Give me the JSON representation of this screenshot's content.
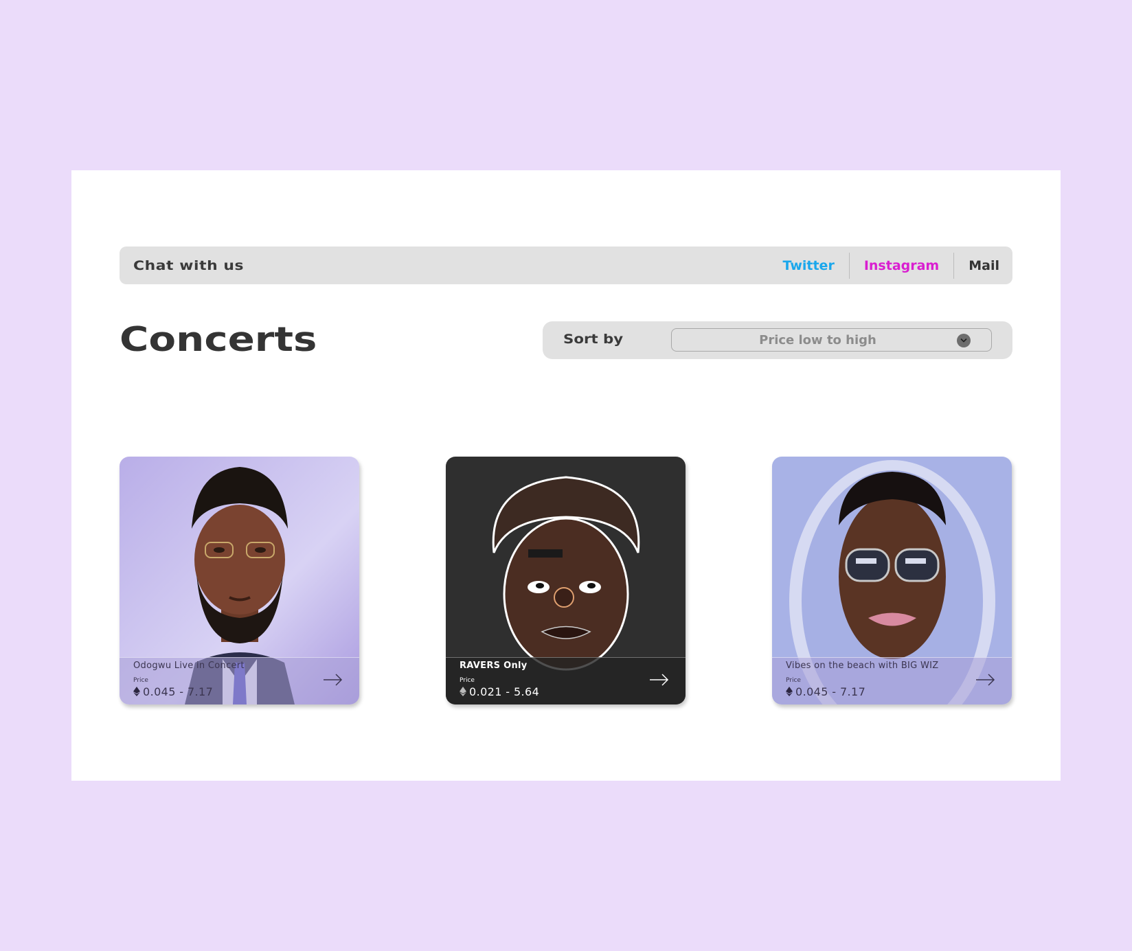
{
  "chat": {
    "label": "Chat with us",
    "links": [
      {
        "label": "Twitter",
        "color": "#1aa7ec"
      },
      {
        "label": "Instagram",
        "color": "#d91ed0"
      },
      {
        "label": "Mail",
        "color": "#333333"
      }
    ]
  },
  "page": {
    "title": "Concerts"
  },
  "sort": {
    "label": "Sort by",
    "selected": "Price low to high"
  },
  "cards": [
    {
      "title": "Odogwu Live in Concert",
      "price_label": "Price",
      "price": "0.045 - 7.17",
      "theme": "light"
    },
    {
      "title": "RAVERS Only",
      "price_label": "Price",
      "price": "0.021 - 5.64",
      "theme": "dark"
    },
    {
      "title": "Vibes on the beach with BIG WIZ",
      "price_label": "Price",
      "price": "0.045 - 7.17",
      "theme": "light"
    }
  ],
  "colors": {
    "background": "#ebdcfa",
    "panel": "#ffffff",
    "bar": "#e1e1e1"
  }
}
